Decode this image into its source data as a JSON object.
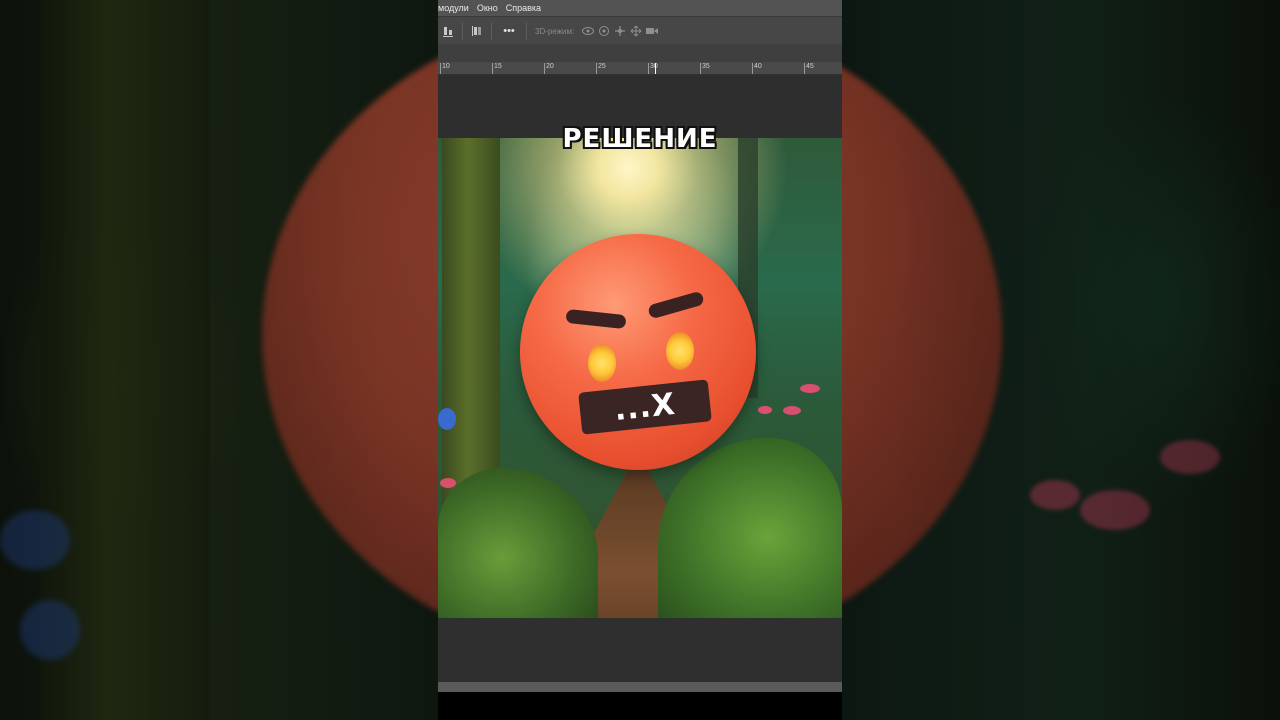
{
  "menu": {
    "items": [
      "модули",
      "Окно",
      "Справка"
    ]
  },
  "options_bar": {
    "more_label": "•••",
    "mode_label": "3D-режим:",
    "icons": [
      "align-bottom-icon",
      "align-left-icon",
      "more-icon",
      "rotate-3d-icon",
      "roll-3d-icon",
      "pan-3d-icon",
      "slide-3d-icon",
      "scale-3d-icon"
    ]
  },
  "ruler": {
    "labels": [
      "10",
      "15",
      "20",
      "25",
      "30",
      "35",
      "40",
      "45"
    ]
  },
  "canvas": {
    "caption": "РЕШЕНИЕ",
    "tape_text": "...X"
  },
  "colors": {
    "app_bg": "#2b2b2b",
    "menubar": "#535353",
    "emoji": "#f66a47"
  }
}
